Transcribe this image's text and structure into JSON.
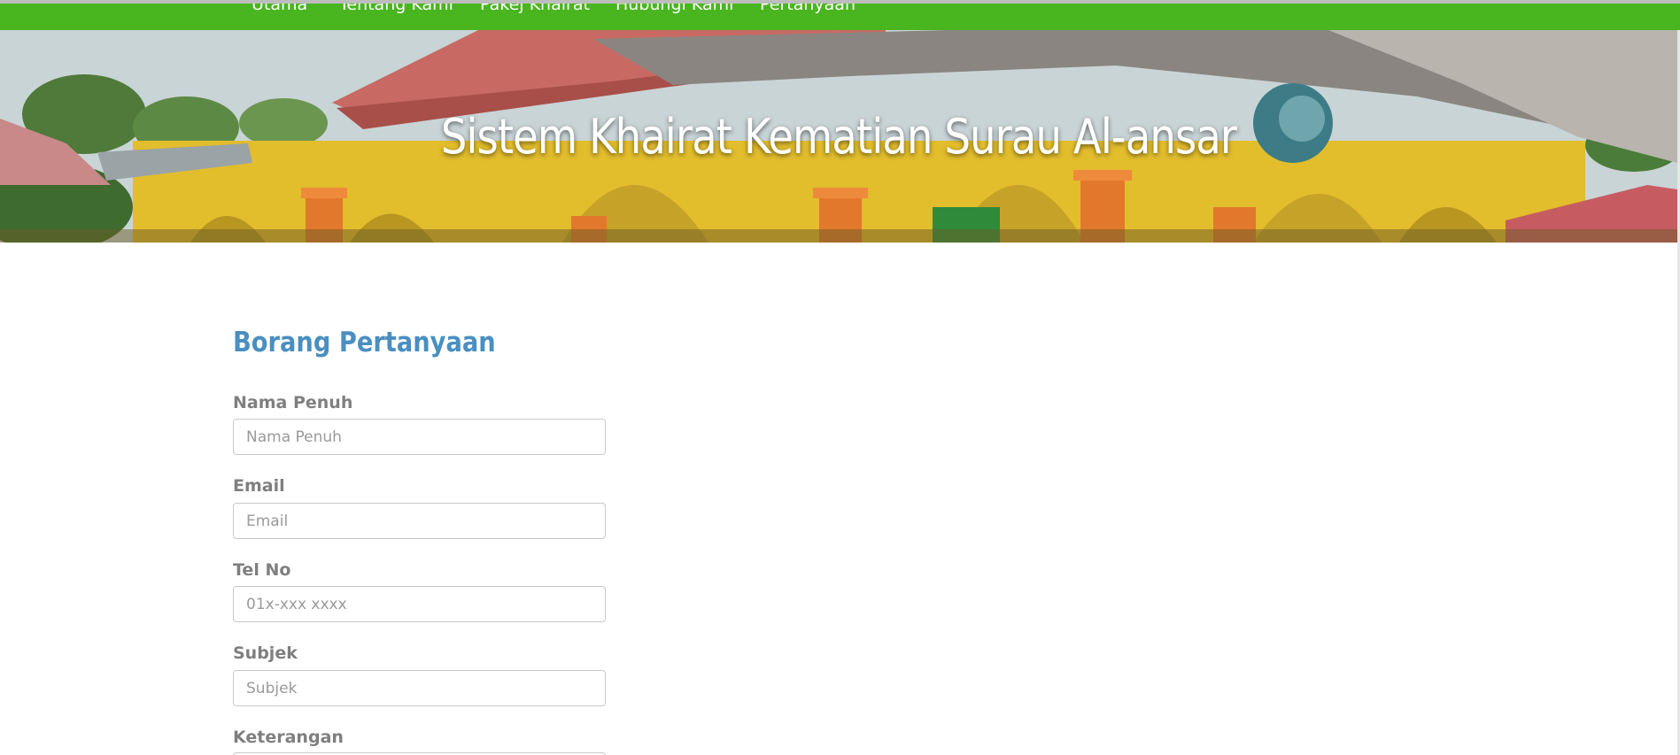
{
  "nav": {
    "items": [
      {
        "label": "Utama"
      },
      {
        "label": "Tentang Kami"
      },
      {
        "label": "Pakej Khairat"
      },
      {
        "label": "Hubungi Kami"
      },
      {
        "label": "Pertanyaan"
      }
    ]
  },
  "hero": {
    "title": "Sistem Khairat Kematian Surau Al-ansar"
  },
  "form": {
    "title": "Borang Pertanyaan",
    "fields": [
      {
        "label": "Nama Penuh",
        "placeholder": "Nama Penuh",
        "value": ""
      },
      {
        "label": "Email",
        "placeholder": "Email",
        "value": ""
      },
      {
        "label": "Tel No",
        "placeholder": "01x-xxx xxxx",
        "value": ""
      },
      {
        "label": "Subjek",
        "placeholder": "Subjek",
        "value": ""
      },
      {
        "label": "Keterangan",
        "placeholder": "",
        "value": ""
      }
    ]
  },
  "colors": {
    "nav_background": "#49b51f",
    "form_title": "#4a8fc1",
    "label_text": "#7f7f7f"
  }
}
